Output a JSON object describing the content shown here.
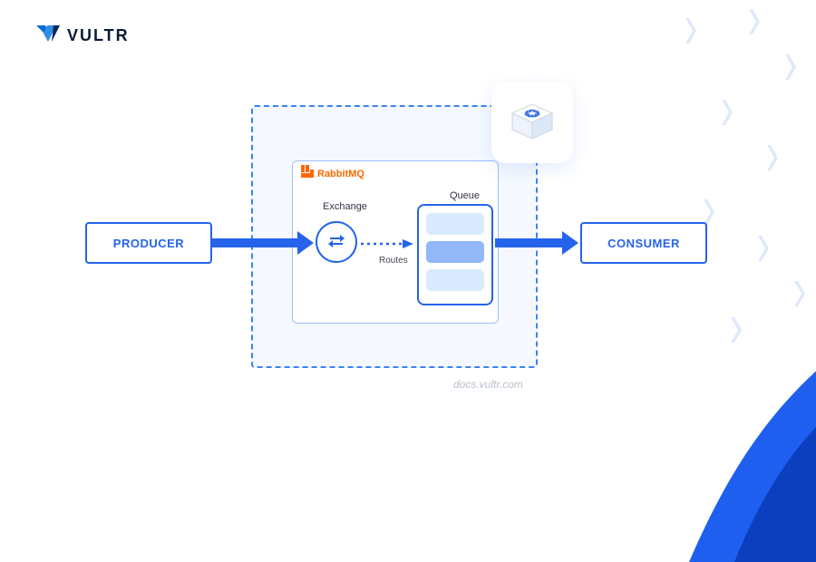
{
  "brand": {
    "name": "VULTR"
  },
  "diagram": {
    "producer_label": "PRODUCER",
    "consumer_label": "CONSUMER",
    "rabbitmq_label": "RabbitMQ",
    "exchange_label": "Exchange",
    "routes_label": "Routes",
    "queue_label": "Queue"
  },
  "watermark": "docs.vultr.com",
  "colors": {
    "primary": "#2563eb",
    "accent_orange": "#ff6600",
    "light_blue": "#dbeafe",
    "muted": "#b7c0cc"
  },
  "icons": {
    "logo": "vultr-logo-icon",
    "rabbit": "rabbitmq-icon",
    "exchange": "swap-arrows-icon",
    "k8s": "kubernetes-cube-icon"
  }
}
